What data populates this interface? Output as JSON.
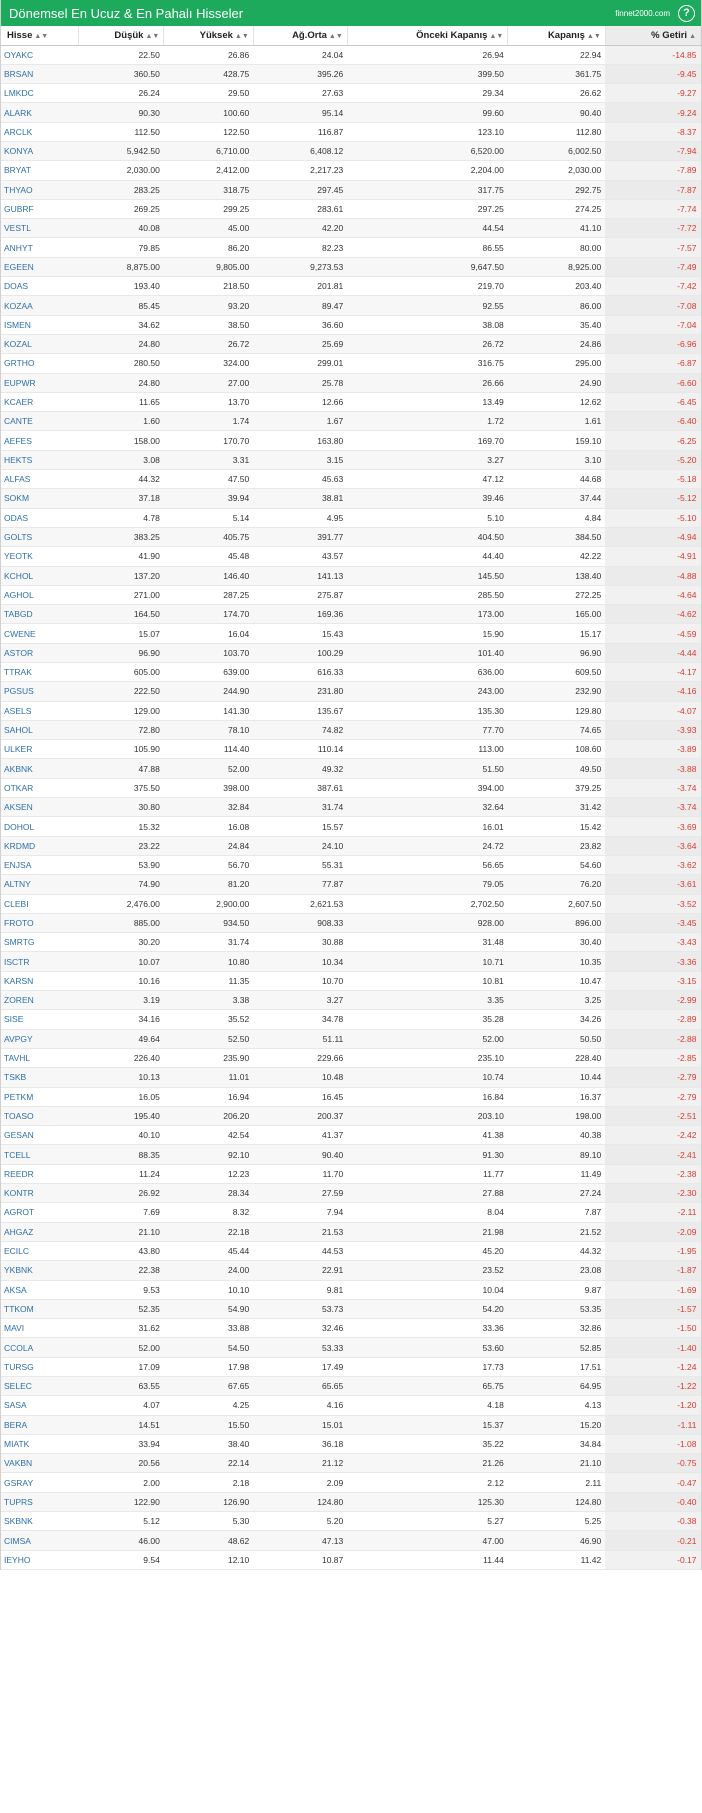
{
  "header": {
    "title": "Dönemsel En Ucuz & En Pahalı Hisseler",
    "brand": "finnet2000.com",
    "help_label": "?"
  },
  "columns": [
    "Hisse",
    "Düşük",
    "Yüksek",
    "Ağ.Orta",
    "Önceki Kapanış",
    "Kapanış",
    "% Getiri"
  ],
  "colors": {
    "header_bg": "#1daa5d",
    "symbol": "#2e6fa7",
    "negative": "#d63a2e"
  },
  "rows": [
    [
      "OYAKC",
      "22.50",
      "26.86",
      "24.04",
      "26.94",
      "22.94",
      "-14.85"
    ],
    [
      "BRSAN",
      "360.50",
      "428.75",
      "395.26",
      "399.50",
      "361.75",
      "-9.45"
    ],
    [
      "LMKDC",
      "26.24",
      "29.50",
      "27.63",
      "29.34",
      "26.62",
      "-9.27"
    ],
    [
      "ALARK",
      "90.30",
      "100.60",
      "95.14",
      "99.60",
      "90.40",
      "-9.24"
    ],
    [
      "ARCLK",
      "112.50",
      "122.50",
      "116.87",
      "123.10",
      "112.80",
      "-8.37"
    ],
    [
      "KONYA",
      "5,942.50",
      "6,710.00",
      "6,408.12",
      "6,520.00",
      "6,002.50",
      "-7.94"
    ],
    [
      "BRYAT",
      "2,030.00",
      "2,412.00",
      "2,217.23",
      "2,204.00",
      "2,030.00",
      "-7.89"
    ],
    [
      "THYAO",
      "283.25",
      "318.75",
      "297.45",
      "317.75",
      "292.75",
      "-7.87"
    ],
    [
      "GUBRF",
      "269.25",
      "299.25",
      "283.61",
      "297.25",
      "274.25",
      "-7.74"
    ],
    [
      "VESTL",
      "40.08",
      "45.00",
      "42.20",
      "44.54",
      "41.10",
      "-7.72"
    ],
    [
      "ANHYT",
      "79.85",
      "86.20",
      "82.23",
      "86.55",
      "80.00",
      "-7.57"
    ],
    [
      "EGEEN",
      "8,875.00",
      "9,805.00",
      "9,273.53",
      "9,647.50",
      "8,925.00",
      "-7.49"
    ],
    [
      "DOAS",
      "193.40",
      "218.50",
      "201.81",
      "219.70",
      "203.40",
      "-7.42"
    ],
    [
      "KOZAA",
      "85.45",
      "93.20",
      "89.47",
      "92.55",
      "86.00",
      "-7.08"
    ],
    [
      "ISMEN",
      "34.62",
      "38.50",
      "36.60",
      "38.08",
      "35.40",
      "-7.04"
    ],
    [
      "KOZAL",
      "24.80",
      "26.72",
      "25.69",
      "26.72",
      "24.86",
      "-6.96"
    ],
    [
      "GRTHO",
      "280.50",
      "324.00",
      "299.01",
      "316.75",
      "295.00",
      "-6.87"
    ],
    [
      "EUPWR",
      "24.80",
      "27.00",
      "25.78",
      "26.66",
      "24.90",
      "-6.60"
    ],
    [
      "KCAER",
      "11.65",
      "13.70",
      "12.66",
      "13.49",
      "12.62",
      "-6.45"
    ],
    [
      "CANTE",
      "1.60",
      "1.74",
      "1.67",
      "1.72",
      "1.61",
      "-6.40"
    ],
    [
      "AEFES",
      "158.00",
      "170.70",
      "163.80",
      "169.70",
      "159.10",
      "-6.25"
    ],
    [
      "HEKTS",
      "3.08",
      "3.31",
      "3.15",
      "3.27",
      "3.10",
      "-5.20"
    ],
    [
      "ALFAS",
      "44.32",
      "47.50",
      "45.63",
      "47.12",
      "44.68",
      "-5.18"
    ],
    [
      "SOKM",
      "37.18",
      "39.94",
      "38.81",
      "39.46",
      "37.44",
      "-5.12"
    ],
    [
      "ODAS",
      "4.78",
      "5.14",
      "4.95",
      "5.10",
      "4.84",
      "-5.10"
    ],
    [
      "GOLTS",
      "383.25",
      "405.75",
      "391.77",
      "404.50",
      "384.50",
      "-4.94"
    ],
    [
      "YEOTK",
      "41.90",
      "45.48",
      "43.57",
      "44.40",
      "42.22",
      "-4.91"
    ],
    [
      "KCHOL",
      "137.20",
      "146.40",
      "141.13",
      "145.50",
      "138.40",
      "-4.88"
    ],
    [
      "AGHOL",
      "271.00",
      "287.25",
      "275.87",
      "285.50",
      "272.25",
      "-4.64"
    ],
    [
      "TABGD",
      "164.50",
      "174.70",
      "169.36",
      "173.00",
      "165.00",
      "-4.62"
    ],
    [
      "CWENE",
      "15.07",
      "16.04",
      "15.43",
      "15.90",
      "15.17",
      "-4.59"
    ],
    [
      "ASTOR",
      "96.90",
      "103.70",
      "100.29",
      "101.40",
      "96.90",
      "-4.44"
    ],
    [
      "TTRAK",
      "605.00",
      "639.00",
      "616.33",
      "636.00",
      "609.50",
      "-4.17"
    ],
    [
      "PGSUS",
      "222.50",
      "244.90",
      "231.80",
      "243.00",
      "232.90",
      "-4.16"
    ],
    [
      "ASELS",
      "129.00",
      "141.30",
      "135.67",
      "135.30",
      "129.80",
      "-4.07"
    ],
    [
      "SAHOL",
      "72.80",
      "78.10",
      "74.82",
      "77.70",
      "74.65",
      "-3.93"
    ],
    [
      "ULKER",
      "105.90",
      "114.40",
      "110.14",
      "113.00",
      "108.60",
      "-3.89"
    ],
    [
      "AKBNK",
      "47.88",
      "52.00",
      "49.32",
      "51.50",
      "49.50",
      "-3.88"
    ],
    [
      "OTKAR",
      "375.50",
      "398.00",
      "387.61",
      "394.00",
      "379.25",
      "-3.74"
    ],
    [
      "AKSEN",
      "30.80",
      "32.84",
      "31.74",
      "32.64",
      "31.42",
      "-3.74"
    ],
    [
      "DOHOL",
      "15.32",
      "16.08",
      "15.57",
      "16.01",
      "15.42",
      "-3.69"
    ],
    [
      "KRDMD",
      "23.22",
      "24.84",
      "24.10",
      "24.72",
      "23.82",
      "-3.64"
    ],
    [
      "ENJSA",
      "53.90",
      "56.70",
      "55.31",
      "56.65",
      "54.60",
      "-3.62"
    ],
    [
      "ALTNY",
      "74.90",
      "81.20",
      "77.87",
      "79.05",
      "76.20",
      "-3.61"
    ],
    [
      "CLEBI",
      "2,476.00",
      "2,900.00",
      "2,621.53",
      "2,702.50",
      "2,607.50",
      "-3.52"
    ],
    [
      "FROTO",
      "885.00",
      "934.50",
      "908.33",
      "928.00",
      "896.00",
      "-3.45"
    ],
    [
      "SMRTG",
      "30.20",
      "31.74",
      "30.88",
      "31.48",
      "30.40",
      "-3.43"
    ],
    [
      "ISCTR",
      "10.07",
      "10.80",
      "10.34",
      "10.71",
      "10.35",
      "-3.36"
    ],
    [
      "KARSN",
      "10.16",
      "11.35",
      "10.70",
      "10.81",
      "10.47",
      "-3.15"
    ],
    [
      "ZOREN",
      "3.19",
      "3.38",
      "3.27",
      "3.35",
      "3.25",
      "-2.99"
    ],
    [
      "SISE",
      "34.16",
      "35.52",
      "34.78",
      "35.28",
      "34.26",
      "-2.89"
    ],
    [
      "AVPGY",
      "49.64",
      "52.50",
      "51.11",
      "52.00",
      "50.50",
      "-2.88"
    ],
    [
      "TAVHL",
      "226.40",
      "235.90",
      "229.66",
      "235.10",
      "228.40",
      "-2.85"
    ],
    [
      "TSKB",
      "10.13",
      "11.01",
      "10.48",
      "10.74",
      "10.44",
      "-2.79"
    ],
    [
      "PETKM",
      "16.05",
      "16.94",
      "16.45",
      "16.84",
      "16.37",
      "-2.79"
    ],
    [
      "TOASO",
      "195.40",
      "206.20",
      "200.37",
      "203.10",
      "198.00",
      "-2.51"
    ],
    [
      "GESAN",
      "40.10",
      "42.54",
      "41.37",
      "41.38",
      "40.38",
      "-2.42"
    ],
    [
      "TCELL",
      "88.35",
      "92.10",
      "90.40",
      "91.30",
      "89.10",
      "-2.41"
    ],
    [
      "REEDR",
      "11.24",
      "12.23",
      "11.70",
      "11.77",
      "11.49",
      "-2.38"
    ],
    [
      "KONTR",
      "26.92",
      "28.34",
      "27.59",
      "27.88",
      "27.24",
      "-2.30"
    ],
    [
      "AGROT",
      "7.69",
      "8.32",
      "7.94",
      "8.04",
      "7.87",
      "-2.11"
    ],
    [
      "AHGAZ",
      "21.10",
      "22.18",
      "21.53",
      "21.98",
      "21.52",
      "-2.09"
    ],
    [
      "ECILC",
      "43.80",
      "45.44",
      "44.53",
      "45.20",
      "44.32",
      "-1.95"
    ],
    [
      "YKBNK",
      "22.38",
      "24.00",
      "22.91",
      "23.52",
      "23.08",
      "-1.87"
    ],
    [
      "AKSA",
      "9.53",
      "10.10",
      "9.81",
      "10.04",
      "9.87",
      "-1.69"
    ],
    [
      "TTKOM",
      "52.35",
      "54.90",
      "53.73",
      "54.20",
      "53.35",
      "-1.57"
    ],
    [
      "MAVI",
      "31.62",
      "33.88",
      "32.46",
      "33.36",
      "32.86",
      "-1.50"
    ],
    [
      "CCOLA",
      "52.00",
      "54.50",
      "53.33",
      "53.60",
      "52.85",
      "-1.40"
    ],
    [
      "TURSG",
      "17.09",
      "17.98",
      "17.49",
      "17.73",
      "17.51",
      "-1.24"
    ],
    [
      "SELEC",
      "63.55",
      "67.65",
      "65.65",
      "65.75",
      "64.95",
      "-1.22"
    ],
    [
      "SASA",
      "4.07",
      "4.25",
      "4.16",
      "4.18",
      "4.13",
      "-1.20"
    ],
    [
      "BERA",
      "14.51",
      "15.50",
      "15.01",
      "15.37",
      "15.20",
      "-1.11"
    ],
    [
      "MIATK",
      "33.94",
      "38.40",
      "36.18",
      "35.22",
      "34.84",
      "-1.08"
    ],
    [
      "VAKBN",
      "20.56",
      "22.14",
      "21.12",
      "21.26",
      "21.10",
      "-0.75"
    ],
    [
      "GSRAY",
      "2.00",
      "2.18",
      "2.09",
      "2.12",
      "2.11",
      "-0.47"
    ],
    [
      "TUPRS",
      "122.90",
      "126.90",
      "124.80",
      "125.30",
      "124.80",
      "-0.40"
    ],
    [
      "SKBNK",
      "5.12",
      "5.30",
      "5.20",
      "5.27",
      "5.25",
      "-0.38"
    ],
    [
      "CIMSA",
      "46.00",
      "48.62",
      "47.13",
      "47.00",
      "46.90",
      "-0.21"
    ],
    [
      "IEYHO",
      "9.54",
      "12.10",
      "10.87",
      "11.44",
      "11.42",
      "-0.17"
    ]
  ]
}
